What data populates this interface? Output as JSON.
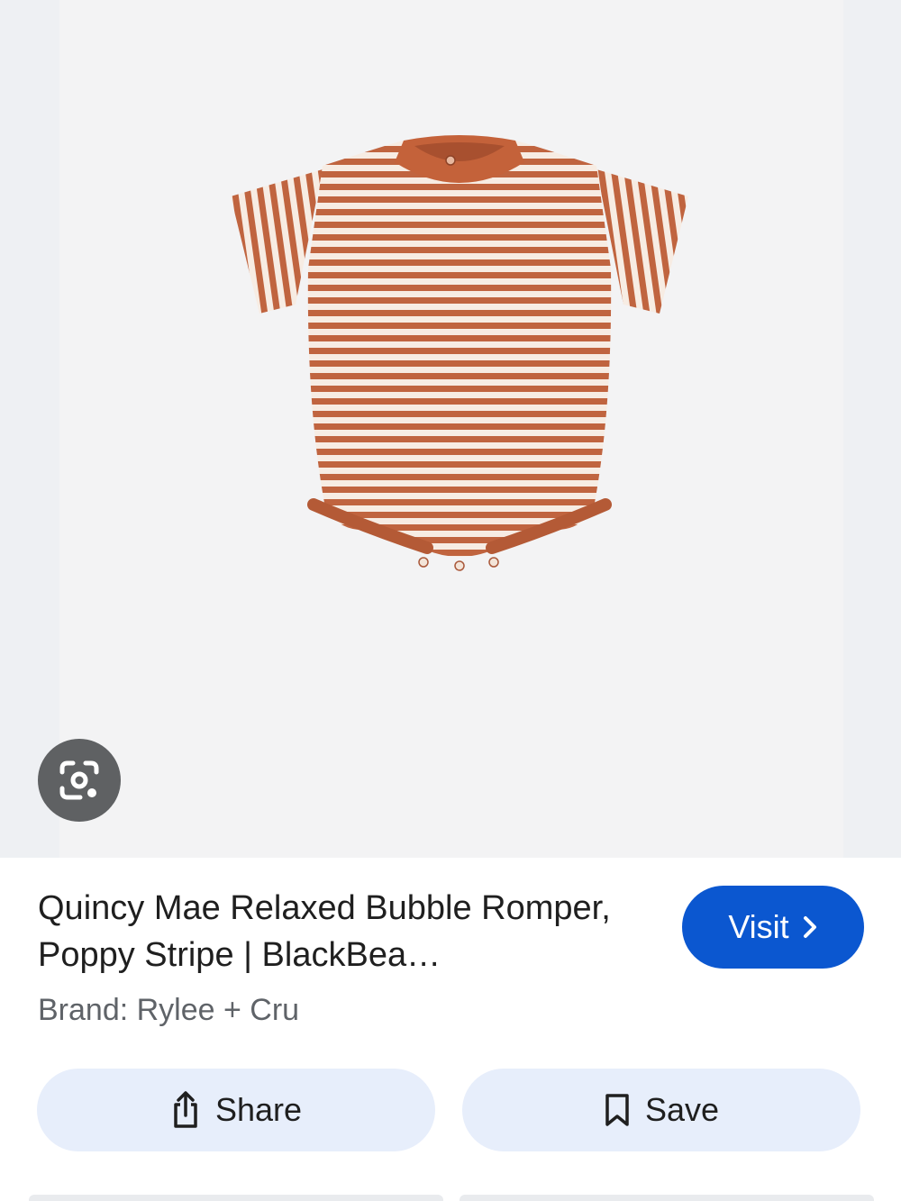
{
  "product": {
    "title": "Quincy Mae Relaxed Bubble Romper, Poppy Stripe | BlackBea…",
    "brand": "Brand: Rylee + Cru",
    "image_description_icon": "striped-romper-image"
  },
  "actions": {
    "visit_label": "Visit",
    "share_label": "Share",
    "save_label": "Save"
  },
  "icons": {
    "lens": "lens-camera-icon",
    "visit": "chevron-right-icon",
    "share": "share-icon",
    "save": "bookmark-icon"
  },
  "colors": {
    "visit_button": "#0b57d0",
    "action_button_bg": "#e7eefb",
    "stripe_rust": "#c0643f",
    "stripe_cream": "#f7ece3"
  }
}
